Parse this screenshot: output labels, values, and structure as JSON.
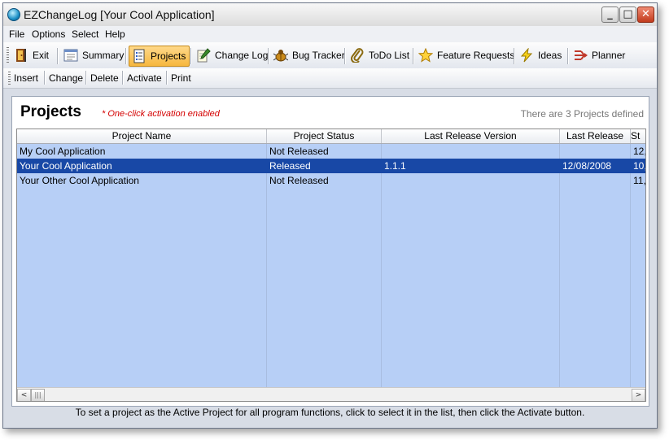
{
  "window": {
    "title": "EZChangeLog [Your Cool Application]",
    "controls": {
      "minimize": "_",
      "maximize": "□",
      "close": "✕"
    }
  },
  "menu": {
    "items": [
      "File",
      "Options",
      "Select",
      "Help"
    ]
  },
  "toolbar_main": {
    "items": [
      {
        "label": "Exit",
        "icon": "exit-door-icon",
        "active": false
      },
      {
        "label": "Summary",
        "icon": "summary-window-icon",
        "active": false
      },
      {
        "label": "Projects",
        "icon": "projects-list-icon",
        "active": true
      },
      {
        "label": "Change Log",
        "icon": "notepad-pencil-icon",
        "active": false
      },
      {
        "label": "Bug Tracker",
        "icon": "bug-icon",
        "active": false
      },
      {
        "label": "ToDo List",
        "icon": "paperclip-icon",
        "active": false
      },
      {
        "label": "Feature Requests",
        "icon": "star-icon",
        "active": false
      },
      {
        "label": "Ideas",
        "icon": "lightning-icon",
        "active": false
      },
      {
        "label": "Planner",
        "icon": "flow-arrows-icon",
        "active": false
      }
    ]
  },
  "toolbar_actions": {
    "items": [
      "Insert",
      "Change",
      "Delete",
      "Activate",
      "Print"
    ]
  },
  "projects_panel": {
    "title": "Projects",
    "activation_note": "* One-click activation enabled",
    "count_text": "There are 3 Projects defined"
  },
  "grid": {
    "columns": [
      "Project Name",
      "Project Status",
      "Last Release Version",
      "Last Release",
      "St"
    ],
    "rows": [
      {
        "cells": [
          "My Cool Application",
          "Not Released",
          "",
          "",
          "12,"
        ],
        "selected": false
      },
      {
        "cells": [
          "Your Cool Application",
          "Released",
          "1.1.1",
          "12/08/2008",
          "10,"
        ],
        "selected": true
      },
      {
        "cells": [
          "Your Other Cool Application",
          "Not Released",
          "",
          "",
          "11,"
        ],
        "selected": false
      }
    ],
    "scroll": {
      "left": "<",
      "right": ">",
      "thumb": "|||"
    }
  },
  "footer": {
    "text": "To set a project as the Active Project for all program functions, click to select it in the list, then click the Activate button."
  },
  "colors": {
    "selection": "#1848a6",
    "grid_background": "#b7cff6",
    "active_tool": "#f6b73e",
    "note_red": "#d40000"
  }
}
